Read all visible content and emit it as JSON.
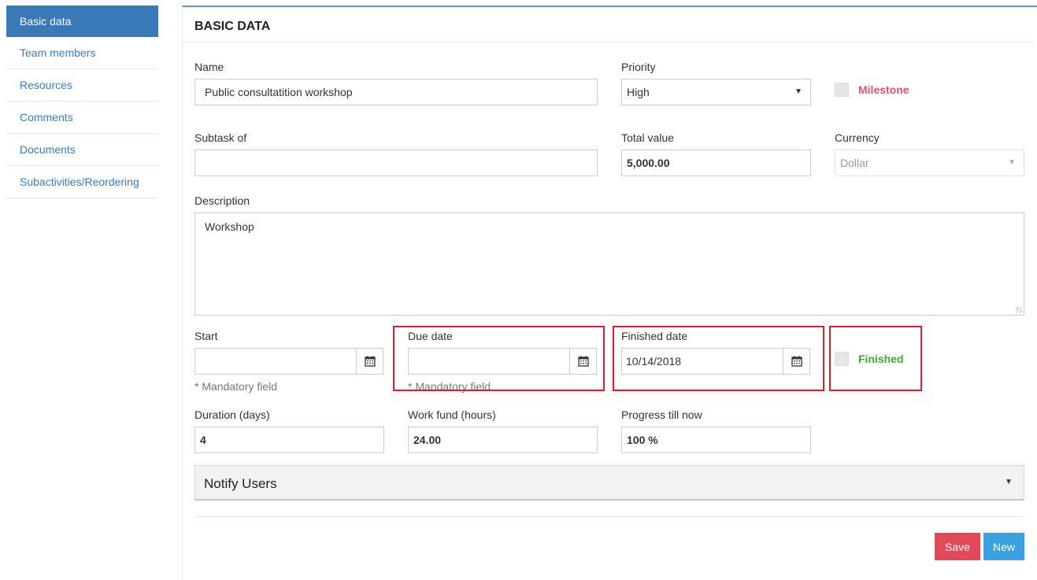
{
  "sidebar": {
    "items": [
      {
        "label": "Basic data",
        "active": true
      },
      {
        "label": "Team members"
      },
      {
        "label": "Resources"
      },
      {
        "label": "Comments"
      },
      {
        "label": "Documents"
      },
      {
        "label": "Subactivities/Reordering"
      }
    ]
  },
  "panel": {
    "title": "BASIC DATA"
  },
  "form": {
    "name": {
      "label": "Name",
      "value": "Public consultatition workshop"
    },
    "priority": {
      "label": "Priority",
      "value": "High"
    },
    "milestone": {
      "label": "Milestone",
      "checked": false,
      "color": "#e05567"
    },
    "subtask_of": {
      "label": "Subtask of",
      "value": ""
    },
    "total_value": {
      "label": "Total value",
      "value": "5,000.00"
    },
    "currency": {
      "label": "Currency",
      "value": "Dollar",
      "disabled": true
    },
    "description": {
      "label": "Description",
      "value": "Workshop"
    },
    "start": {
      "label": "Start",
      "value": "",
      "hint": "* Mandatory field"
    },
    "due_date": {
      "label": "Due date",
      "value": "",
      "hint": "* Mandatory field"
    },
    "finished_date": {
      "label": "Finished date",
      "value": "10/14/2018"
    },
    "finished": {
      "label": "Finished",
      "checked": false,
      "color": "#3fa63a"
    },
    "duration": {
      "label": "Duration (days)",
      "value": "4"
    },
    "work_fund": {
      "label": "Work fund (hours)",
      "value": "24.00"
    },
    "progress": {
      "label": "Progress till now",
      "value": "100 %"
    }
  },
  "notify": {
    "title": "Notify Users"
  },
  "actions": {
    "save_label": "Save",
    "new_label": "New"
  },
  "icons": {
    "calendar": "calendar-icon",
    "dropdown": "caret-down-icon"
  },
  "colors": {
    "accent": "#3a79b8",
    "highlight": "#d9202a",
    "save": "#e04a5a",
    "new": "#3aa0e0"
  }
}
